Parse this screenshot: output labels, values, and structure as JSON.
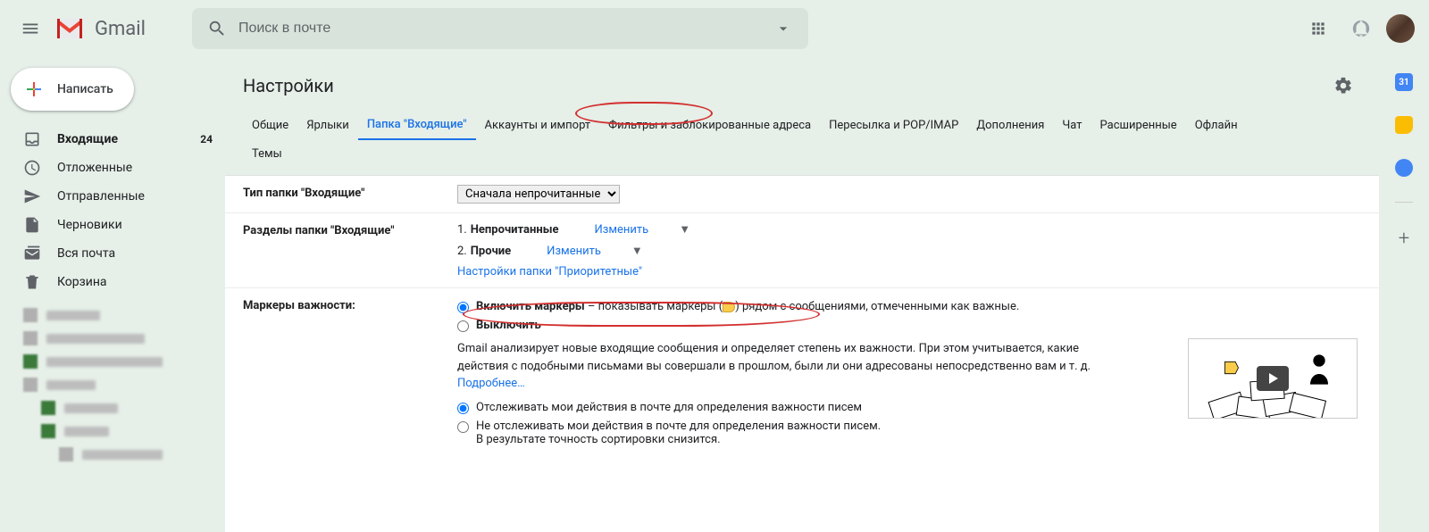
{
  "header": {
    "logo_text": "Gmail",
    "search_placeholder": "Поиск в почте"
  },
  "sidebar": {
    "compose_label": "Написать",
    "items": [
      {
        "label": "Входящие",
        "count": "24"
      },
      {
        "label": "Отложенные"
      },
      {
        "label": "Отправленные"
      },
      {
        "label": "Черновики"
      },
      {
        "label": "Вся почта"
      },
      {
        "label": "Корзина"
      }
    ]
  },
  "settings": {
    "title": "Настройки",
    "tabs": [
      "Общие",
      "Ярлыки",
      "Папка \"Входящие\"",
      "Аккаунты и импорт",
      "Фильтры и заблокированные адреса",
      "Пересылка и POP/IMAP",
      "Дополнения",
      "Чат",
      "Расширенные",
      "Офлайн",
      "Темы"
    ],
    "inbox_type": {
      "label": "Тип папки \"Входящие\"",
      "value": "Сначала непрочитанные"
    },
    "sections": {
      "label": "Разделы папки \"Входящие\"",
      "rows": [
        {
          "num": "1.",
          "name": "Непрочитанные",
          "change": "Изменить"
        },
        {
          "num": "2.",
          "name": "Прочие",
          "change": "Изменить"
        }
      ],
      "priority_link": "Настройки папки \"Приоритетные\""
    },
    "markers": {
      "label": "Маркеры важности:",
      "on_label": "Включить маркеры",
      "on_desc_before": " – показывать маркеры (",
      "on_desc_after": ") рядом с сообщениями, отмеченными как важные.",
      "off_label": "Выключить",
      "paragraph": "Gmail анализирует новые входящие сообщения и определяет степень их важности. При этом учитывается, какие действия с подобными письмами вы совершали в прошлом, были ли они адресованы непосредственно вам и т. д. ",
      "learn_more": "Подробнее…",
      "track_on": "Отслеживать мои действия в почте для определения важности писем",
      "track_off": "Не отслеживать мои действия в почте для определения важности писем.",
      "track_off_note": "В результате точность сортировки снизится."
    }
  }
}
